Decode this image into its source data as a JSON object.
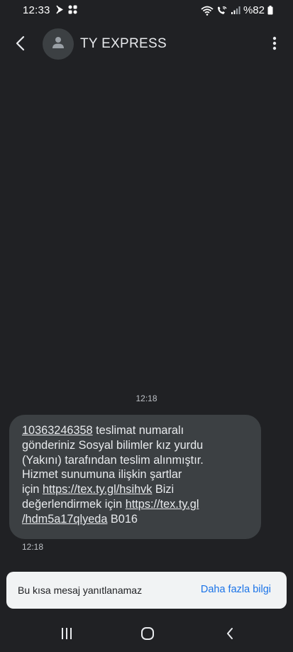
{
  "status_bar": {
    "time": "12:33",
    "battery": "%82",
    "icons": [
      "media-play-icon",
      "apps-grid-icon",
      "wifi-icon",
      "wifi-call-icon",
      "signal-icon",
      "battery-icon"
    ]
  },
  "header": {
    "contact_name": "TY EXPRESS",
    "icons": [
      "back-arrow-icon",
      "person-icon",
      "more-vert-icon"
    ]
  },
  "conversation": {
    "date_stamp": "12:18",
    "message": {
      "lines": [
        {
          "link": "10363246358",
          "text": " teslimat numaralı"
        },
        {
          "text": "gönderiniz Sosyal bilimler kız yurdu"
        },
        {
          "text": "(Yakını)  tarafından teslim alınmıştır."
        },
        {
          "text": "Hizmet sunumuna ilişkin şartlar"
        },
        {
          "pre": "için ",
          "link": "https://tex.ty.gl/hsihvk",
          "post": " Bizi"
        },
        {
          "pre": "değerlendirmek için ",
          "link": "https://tex.ty.gl"
        },
        {
          "link": "/hdm5a17qlyeda",
          "post": " B016"
        }
      ],
      "time": "12:18"
    }
  },
  "reply_banner": {
    "text": "Bu kısa mesaj yanıtlanamaz",
    "link": "Daha fazla bilgi"
  },
  "nav_bar": {
    "icons": [
      "recents-icon",
      "home-icon",
      "back-icon"
    ]
  },
  "colors": {
    "background": "#202124",
    "bubble": "#3c4043",
    "banner": "#f1f3f4",
    "link_accent": "#1a73e8"
  }
}
